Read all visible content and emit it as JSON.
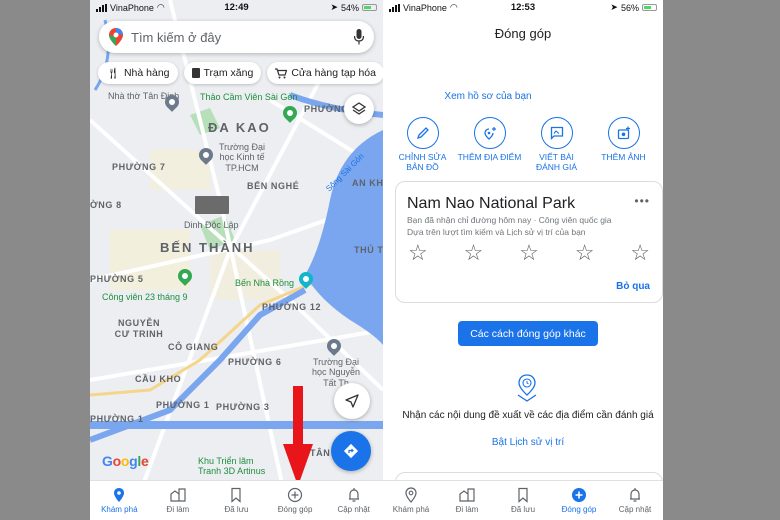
{
  "left_screen": {
    "status_bar": {
      "carrier": "VinaPhone",
      "time": "12:49",
      "battery": "54%"
    },
    "search": {
      "placeholder": "Tìm kiếm ở đây"
    },
    "chips": [
      {
        "icon": "fork-knife-icon",
        "label": "Nhà hàng"
      },
      {
        "icon": "gas-pump-icon",
        "label": "Trạm xăng"
      },
      {
        "icon": "cart-icon",
        "label": "Cửa hàng tạp hóa"
      }
    ],
    "map_labels": {
      "nha_tho": "Nhà thờ Tân Định",
      "thao_cam_vien": "Thảo Cầm Viên Sài Gòn",
      "phuong_top": "PHƯỜNG",
      "da_kao": "ĐA KAO",
      "truong_kinh_te": "Trường Đại học Kinh tế TP.HCM",
      "phuong7": "PHƯỜNG 7",
      "ben_nghe": "BẾN NGHÉ",
      "song_sai_gon": "Sông Sài Gòn",
      "an_khanh": "AN KH",
      "phuong8": "ỜNG 8",
      "dinh_doc_lap": "Dinh Độc Lập",
      "ben_thanh": "BẾN THÀNH",
      "thu_thiem": "THỦ T",
      "phuong5": "PHƯỜNG 5",
      "ben_nha_rong": "Bến Nhà Rồng",
      "cong_vien": "Công viên 23 tháng 9",
      "phuong12": "PHƯỜNG 12",
      "nguyen_cu_trinh": "NGUYỄN CƯ TRINH",
      "co_giang": "CÔ GIANG",
      "phuong6": "PHƯỜNG 6",
      "truong_nguyen_tat_thanh": "Trường Đại học Nguyễn Tất Th",
      "cau_kho": "CẦU KHO",
      "phuong1a": "PHƯỜNG 1",
      "phuong3": "PHƯỜNG 3",
      "phuong1b": "PHƯỜNG 1",
      "tan": "TÂN",
      "khu_trien_lam": "Khu Triển lãm Tranh 3D Artinus"
    },
    "google_logo": "Google",
    "tabs": [
      {
        "label": "Khám phá",
        "icon": "pin-icon",
        "active": true
      },
      {
        "label": "Đi làm",
        "icon": "building-icon",
        "active": false
      },
      {
        "label": "Đã lưu",
        "icon": "bookmark-icon",
        "active": false
      },
      {
        "label": "Đóng góp",
        "icon": "plus-circle-icon",
        "active": false
      },
      {
        "label": "Cập nhật",
        "icon": "bell-icon",
        "active": false
      }
    ]
  },
  "right_screen": {
    "status_bar": {
      "carrier": "VinaPhone",
      "time": "12:53",
      "battery": "56%"
    },
    "title": "Đóng góp",
    "profile_link": "Xem hồ sơ của bạn",
    "actions": [
      {
        "icon": "pencil-icon",
        "label": "CHỈNH SỬA BẢN ĐỒ"
      },
      {
        "icon": "add-place-icon",
        "label": "THÊM ĐỊA ĐIỂM"
      },
      {
        "icon": "review-icon",
        "label": "VIẾT BÀI ĐÁNH GIÁ"
      },
      {
        "icon": "add-photo-icon",
        "label": "THÊM ẢNH"
      }
    ],
    "card": {
      "title": "Nam Nao National Park",
      "line1": "Bạn đã nhận chỉ đường hôm nay · Công viên quốc gia",
      "line2": "Dựa trên lượt tìm kiếm và Lịch sử vị trí của bạn",
      "rating": 0,
      "max_rating": 5,
      "skip": "Bỏ qua"
    },
    "other_ways_button": "Các cách đóng góp khác",
    "suggest_text": "Nhận các nội dung đề xuất về các địa điểm cần đánh giá",
    "enable_history_link": "Bật Lịch sử vị trí",
    "tabs": [
      {
        "label": "Khám phá",
        "icon": "pin-icon",
        "active": false
      },
      {
        "label": "Đi làm",
        "icon": "building-icon",
        "active": false
      },
      {
        "label": "Đã lưu",
        "icon": "bookmark-icon",
        "active": false
      },
      {
        "label": "Đóng góp",
        "icon": "plus-circle-icon",
        "active": true
      },
      {
        "label": "Cập nhật",
        "icon": "bell-icon",
        "active": false
      }
    ]
  },
  "colors": {
    "accent": "#1a73e8",
    "arrow": "#e8161b",
    "map_bg": "#e9eaee",
    "water": "#7aa6f0"
  }
}
